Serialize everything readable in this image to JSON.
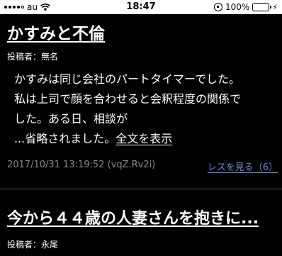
{
  "status_bar": {
    "carrier": "au",
    "time": "18:47",
    "battery": "100%"
  },
  "posts": [
    {
      "title": "かすみと不倫",
      "poster": "投稿者：無名",
      "body_lines": [
        "かすみは同じ会社のパートタイマーでした。",
        "私は上司で顔を合わせると会釈程度の関係で",
        "した。ある日、相談が"
      ],
      "truncated_text": "...省略されました。",
      "more_link": "全文を表示",
      "datetime": "2017/10/31 13:19:52 (vqZ.Rv2i)",
      "res_link": "レスを見る（6）"
    },
    {
      "title": "今から４４歳の人妻さんを抱きに...",
      "poster": "投稿者：永尾"
    }
  ]
}
